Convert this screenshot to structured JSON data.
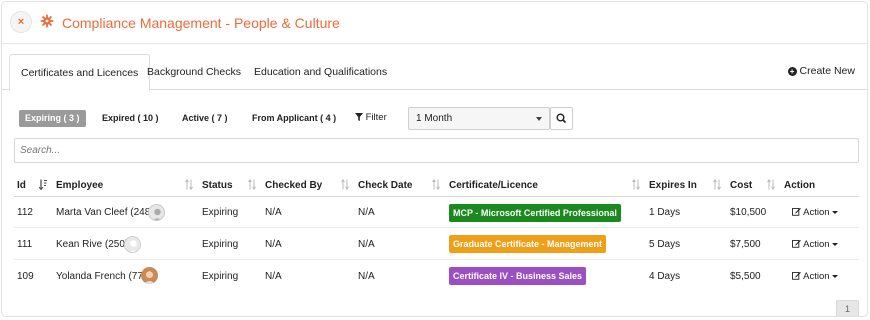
{
  "header": {
    "close_label": "×",
    "title": "Compliance Management - People & Culture",
    "accent_color": "#ee6a3a"
  },
  "tabs": [
    {
      "label": "Certificates and Licences",
      "active": true
    },
    {
      "label": "Background Checks",
      "active": false
    },
    {
      "label": "Education and Qualifications",
      "active": false
    }
  ],
  "create_new_label": "Create New",
  "filters": {
    "pills": [
      {
        "label": "Expiring ( 3 )",
        "active": true
      },
      {
        "label": "Expired ( 10 )",
        "active": false
      },
      {
        "label": "Active ( 7 )",
        "active": false
      },
      {
        "label": "From Applicant ( 4 )",
        "active": false
      }
    ],
    "filter_label": "Filter",
    "period_selected": "1 Month"
  },
  "search": {
    "placeholder": "Search...",
    "value": ""
  },
  "table": {
    "columns": [
      "Id",
      "Employee",
      "Status",
      "Checked By",
      "Check Date",
      "Certificate/Licence",
      "Expires In",
      "Cost",
      "Action"
    ],
    "rows": [
      {
        "id": "112",
        "employee": "Marta Van Cleef (248)",
        "status": "Expiring",
        "checked_by": "N/A",
        "check_date": "N/A",
        "certificate": "MCP - Microsoft Certified Professional",
        "certificate_color": "#1a8a1e",
        "expires_in": "1 Days",
        "cost": "$10,500",
        "action": "Action"
      },
      {
        "id": "111",
        "employee": "Kean Rive (250)",
        "status": "Expiring",
        "checked_by": "N/A",
        "check_date": "N/A",
        "certificate": "Graduate Certificate - Management",
        "certificate_color": "#f0a018",
        "expires_in": "5 Days",
        "cost": "$7,500",
        "action": "Action"
      },
      {
        "id": "109",
        "employee": "Yolanda French (77)",
        "status": "Expiring",
        "checked_by": "N/A",
        "check_date": "N/A",
        "certificate": "Certificate IV - Business Sales",
        "certificate_color": "#9b4fc1",
        "expires_in": "4 Days",
        "cost": "$5,500",
        "action": "Action"
      }
    ]
  },
  "pagination": {
    "current_page": "1"
  }
}
